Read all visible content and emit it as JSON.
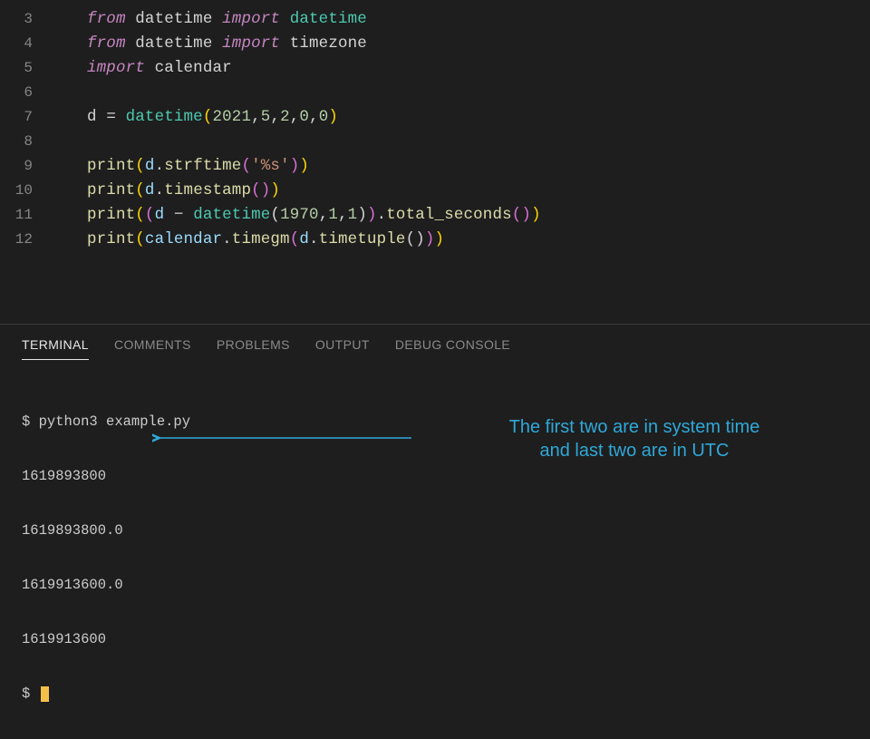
{
  "editor": {
    "lines": [
      {
        "num": "3",
        "tokens": [
          [
            "kw-it",
            "from"
          ],
          [
            "p",
            " "
          ],
          [
            "mod",
            "datetime"
          ],
          [
            "p",
            " "
          ],
          [
            "kw-it",
            "import"
          ],
          [
            "p",
            " "
          ],
          [
            "cls",
            "datetime"
          ]
        ]
      },
      {
        "num": "4",
        "tokens": [
          [
            "kw-it",
            "from"
          ],
          [
            "p",
            " "
          ],
          [
            "mod",
            "datetime"
          ],
          [
            "p",
            " "
          ],
          [
            "kw-it",
            "import"
          ],
          [
            "p",
            " "
          ],
          [
            "mod",
            "timezone"
          ]
        ]
      },
      {
        "num": "5",
        "tokens": [
          [
            "kw-it",
            "import"
          ],
          [
            "p",
            " "
          ],
          [
            "mod",
            "calendar"
          ]
        ]
      },
      {
        "num": "6",
        "tokens": []
      },
      {
        "num": "7",
        "tokens": [
          [
            "var",
            "d "
          ],
          [
            "op",
            "="
          ],
          [
            "p",
            " "
          ],
          [
            "cls",
            "datetime"
          ],
          [
            "y",
            "("
          ],
          [
            "num",
            "2021"
          ],
          [
            "p",
            ","
          ],
          [
            "num",
            "5"
          ],
          [
            "p",
            ","
          ],
          [
            "num",
            "2"
          ],
          [
            "p",
            ","
          ],
          [
            "num",
            "0"
          ],
          [
            "p",
            ","
          ],
          [
            "num",
            "0"
          ],
          [
            "y",
            ")"
          ]
        ]
      },
      {
        "num": "8",
        "tokens": []
      },
      {
        "num": "9",
        "tokens": [
          [
            "fn",
            "print"
          ],
          [
            "y",
            "("
          ],
          [
            "obj",
            "d"
          ],
          [
            "p",
            "."
          ],
          [
            "fn",
            "strftime"
          ],
          [
            "pk",
            "("
          ],
          [
            "str",
            "'%s'"
          ],
          [
            "pk",
            ")"
          ],
          [
            "y",
            ")"
          ]
        ]
      },
      {
        "num": "10",
        "tokens": [
          [
            "fn",
            "print"
          ],
          [
            "y",
            "("
          ],
          [
            "obj",
            "d"
          ],
          [
            "p",
            "."
          ],
          [
            "fn",
            "timestamp"
          ],
          [
            "pk",
            "("
          ],
          [
            "pk",
            ")"
          ],
          [
            "y",
            ")"
          ]
        ]
      },
      {
        "num": "11",
        "tokens": [
          [
            "fn",
            "print"
          ],
          [
            "y",
            "("
          ],
          [
            "pk",
            "("
          ],
          [
            "obj",
            "d "
          ],
          [
            "op",
            "−"
          ],
          [
            "p",
            " "
          ],
          [
            "cls",
            "datetime"
          ],
          [
            "p",
            "("
          ],
          [
            "num",
            "1970"
          ],
          [
            "p",
            ","
          ],
          [
            "num",
            "1"
          ],
          [
            "p",
            ","
          ],
          [
            "num",
            "1"
          ],
          [
            "p",
            ")"
          ],
          [
            "pk",
            ")"
          ],
          [
            "p",
            "."
          ],
          [
            "fn",
            "total_seconds"
          ],
          [
            "pk",
            "("
          ],
          [
            "pk",
            ")"
          ],
          [
            "y",
            ")"
          ]
        ]
      },
      {
        "num": "12",
        "tokens": [
          [
            "fn",
            "print"
          ],
          [
            "y",
            "("
          ],
          [
            "obj",
            "calendar"
          ],
          [
            "p",
            "."
          ],
          [
            "fn",
            "timegm"
          ],
          [
            "pk",
            "("
          ],
          [
            "obj",
            "d"
          ],
          [
            "p",
            "."
          ],
          [
            "fn",
            "timetuple"
          ],
          [
            "p",
            "("
          ],
          [
            "p",
            ")"
          ],
          [
            "pk",
            ")"
          ],
          [
            "y",
            ")"
          ]
        ]
      }
    ]
  },
  "panel": {
    "tabs": [
      "TERMINAL",
      "COMMENTS",
      "PROBLEMS",
      "OUTPUT",
      "DEBUG CONSOLE"
    ],
    "active_tab": 0,
    "terminal": {
      "prompt": "$ ",
      "command": "python3 example.py",
      "output": [
        "1619893800",
        "1619893800.0",
        "1619913600.0",
        "1619913600"
      ]
    }
  },
  "annotation": {
    "line1": "The first two are in system time",
    "line2": "and last two are in UTC"
  }
}
